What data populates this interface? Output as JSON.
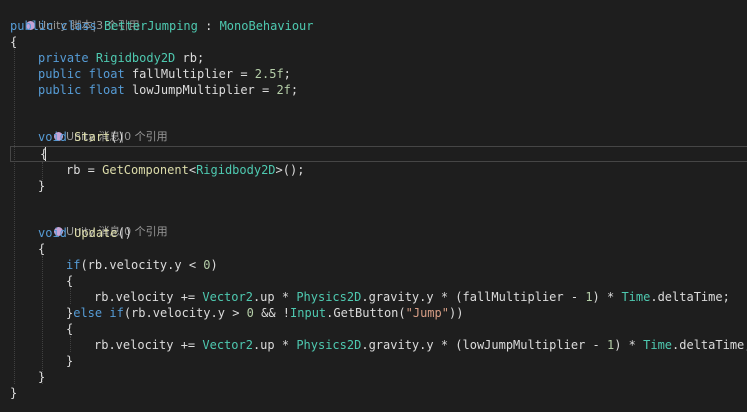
{
  "editor": {
    "codelens": [
      {
        "text": "Unity 脚本|3 个引用"
      },
      {
        "text": "Unity 消息|0 个引用"
      },
      {
        "text": "Unity 消息|0 个引用"
      }
    ],
    "tokens": {
      "public": "public",
      "class": "class",
      "class_name": "BetterJumping",
      "colon": ":",
      "base_class": "MonoBehaviour",
      "open_brace": "{",
      "close_brace": "}",
      "private": "private",
      "rigidbody2d": "Rigidbody2D",
      "rb_decl": " rb;",
      "float": "float",
      "fall_multiplier": " fallMultiplier = ",
      "fall_value": "2.5f",
      "semicolon": ";",
      "low_jump_multiplier": " lowJumpMultiplier = ",
      "low_jump_value": "2f",
      "void": "void",
      "start": "Start",
      "parens": "()",
      "rb_assign": "rb = ",
      "get_component": "GetComponent",
      "lt": "<",
      "gt_call": ">();",
      "update": "Update",
      "if": "if",
      "if_cond": "(rb.velocity.y < ",
      "zero": "0",
      "close_paren": ")",
      "velocity_plus": "rb.velocity += ",
      "vector2": "Vector2",
      "dot_up": ".up * ",
      "physics2d": "Physics2D",
      "gravity_y": ".gravity.y * (fallMultiplier - ",
      "gravity_y_low": ".gravity.y * (lowJumpMultiplier - ",
      "one": "1",
      "close_mult": ") * ",
      "time": "Time",
      "delta_time": ".deltaTime;",
      "else": "else",
      "if_cond2": "(rb.velocity.y > ",
      "and_not": " && !",
      "input": "Input",
      "get_button": ".GetButton(",
      "jump_str": "\"Jump\"",
      "close_paren2": "))"
    }
  }
}
